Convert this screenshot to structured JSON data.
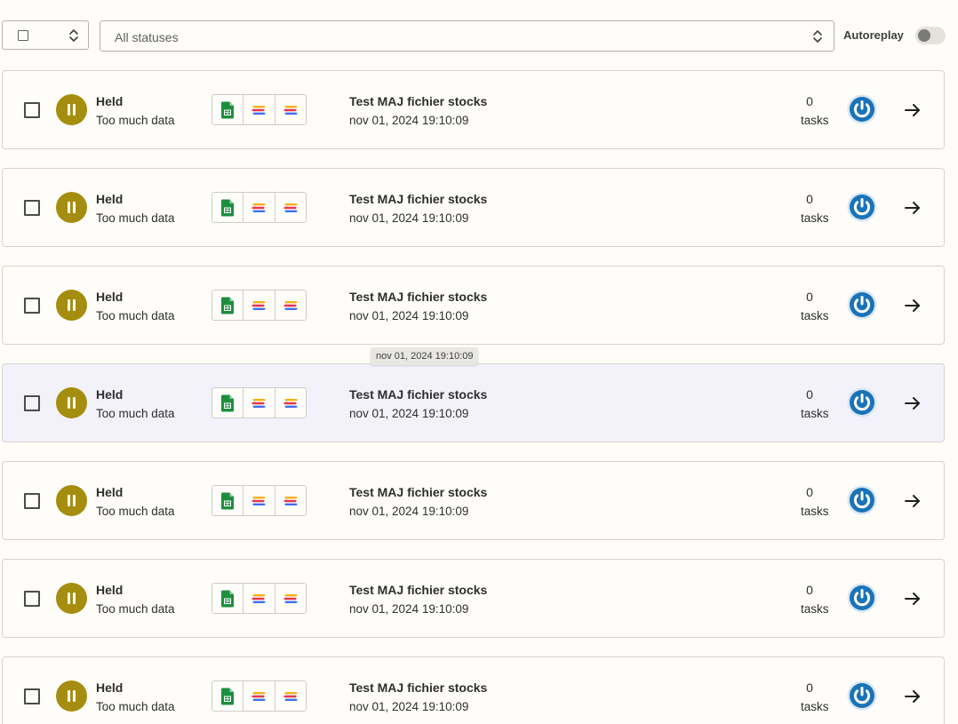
{
  "filters": {
    "status_select_label": "All statuses",
    "autoreplay_label": "Autoreplay",
    "autoreplay_on": false
  },
  "tooltip": {
    "text": "nov 01, 2024 19:10:09"
  },
  "colors": {
    "held": "#a58d0f",
    "power": "#1a73b8",
    "sheets": "#1e8e3e",
    "hover_row": "#f3f2fb"
  },
  "rows": [
    {
      "status": "Held",
      "reason": "Too much data",
      "apps": [
        "google-sheets-icon",
        "stacked-logo-icon",
        "stacked-logo-icon"
      ],
      "zap_name": "Test MAJ fichier stocks",
      "date": "nov 01, 2024 19:10:09",
      "tasks": "0",
      "tasks_label": "tasks"
    },
    {
      "status": "Held",
      "reason": "Too much data",
      "apps": [
        "google-sheets-icon",
        "stacked-logo-icon",
        "stacked-logo-icon"
      ],
      "zap_name": "Test MAJ fichier stocks",
      "date": "nov 01, 2024 19:10:09",
      "tasks": "0",
      "tasks_label": "tasks"
    },
    {
      "status": "Held",
      "reason": "Too much data",
      "apps": [
        "google-sheets-icon",
        "stacked-logo-icon",
        "stacked-logo-icon"
      ],
      "zap_name": "Test MAJ fichier stocks",
      "date": "nov 01, 2024 19:10:09",
      "tasks": "0",
      "tasks_label": "tasks"
    },
    {
      "status": "Held",
      "reason": "Too much data",
      "apps": [
        "google-sheets-icon",
        "stacked-logo-icon",
        "stacked-logo-icon"
      ],
      "zap_name": "Test MAJ fichier stocks",
      "date": "nov 01, 2024 19:10:09",
      "tasks": "0",
      "tasks_label": "tasks",
      "hovered": true
    },
    {
      "status": "Held",
      "reason": "Too much data",
      "apps": [
        "google-sheets-icon",
        "stacked-logo-icon",
        "stacked-logo-icon"
      ],
      "zap_name": "Test MAJ fichier stocks",
      "date": "nov 01, 2024 19:10:09",
      "tasks": "0",
      "tasks_label": "tasks"
    },
    {
      "status": "Held",
      "reason": "Too much data",
      "apps": [
        "google-sheets-icon",
        "stacked-logo-icon",
        "stacked-logo-icon"
      ],
      "zap_name": "Test MAJ fichier stocks",
      "date": "nov 01, 2024 19:10:09",
      "tasks": "0",
      "tasks_label": "tasks"
    },
    {
      "status": "Held",
      "reason": "Too much data",
      "apps": [
        "google-sheets-icon",
        "stacked-logo-icon",
        "stacked-logo-icon"
      ],
      "zap_name": "Test MAJ fichier stocks",
      "date": "nov 01, 2024 19:10:09",
      "tasks": "0",
      "tasks_label": "tasks"
    }
  ]
}
